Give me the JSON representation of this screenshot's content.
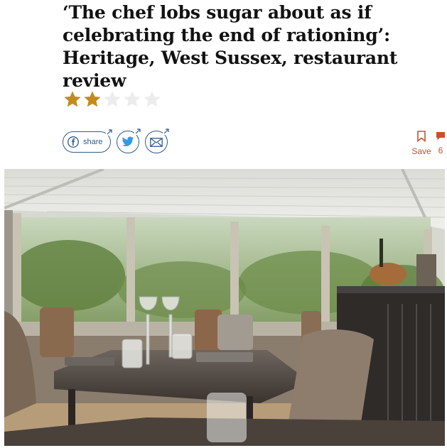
{
  "article": {
    "headline": "‘The chef lobs sugar about as if celebrating the end of rationing’: Heritage, West Sussex, restaurant review",
    "rating": {
      "value": 2,
      "max": 5
    }
  },
  "social": {
    "share_label": "share",
    "save_label": "Save",
    "comments_count": "6"
  },
  "colors": {
    "star_filled": "#c58a1c",
    "star_empty": "#ececec",
    "share_blue": "#2e5c8a",
    "accent_orange": "#c7512a"
  },
  "icons": [
    "facebook-icon",
    "twitter-icon",
    "email-icon",
    "bookmark-icon",
    "comment-icon"
  ]
}
